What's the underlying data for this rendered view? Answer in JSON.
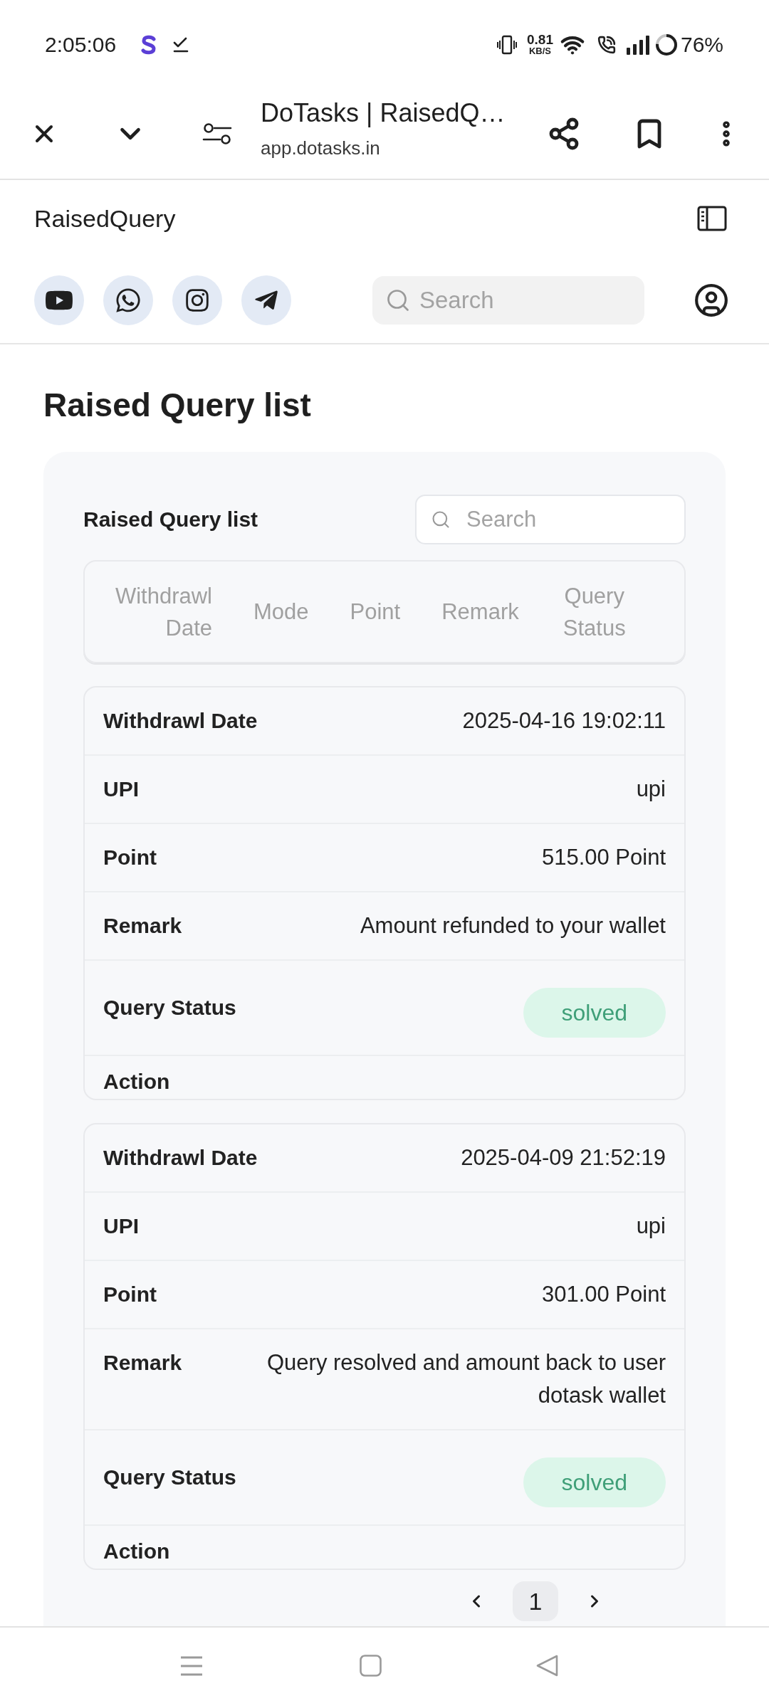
{
  "status_bar": {
    "time": "2:05:06",
    "network_speed": "0.81",
    "network_speed_unit": "KB/S",
    "battery": "76%"
  },
  "browser_bar": {
    "title": "DoTasks | RaisedQ…",
    "url": "app.dotasks.in"
  },
  "site_header": {
    "title": "RaisedQuery",
    "search": {
      "placeholder": "Search"
    }
  },
  "page_title": "Raised Query list",
  "panel": {
    "title": "Raised Query list",
    "search": {
      "placeholder": "Search"
    },
    "table": {
      "columns": [
        "Withdrawl Date",
        "Mode",
        "Point",
        "Remark",
        "Query Status"
      ]
    },
    "records": [
      {
        "fields": [
          {
            "kind": "text",
            "label": "Withdrawl Date",
            "value": "2025-04-16 19:02:11"
          },
          {
            "kind": "text",
            "label": "UPI",
            "value": "upi"
          },
          {
            "kind": "text",
            "label": "Point",
            "value": "515.00 Point"
          },
          {
            "kind": "text",
            "label": "Remark",
            "value": "Amount refunded to your wallet"
          },
          {
            "kind": "badge",
            "label": "Query Status",
            "value": "solved"
          },
          {
            "kind": "action",
            "label": "Action"
          }
        ]
      },
      {
        "fields": [
          {
            "kind": "text",
            "label": "Withdrawl Date",
            "value": "2025-04-09 21:52:19"
          },
          {
            "kind": "text",
            "label": "UPI",
            "value": "upi"
          },
          {
            "kind": "text",
            "label": "Point",
            "value": "301.00 Point"
          },
          {
            "kind": "text",
            "label": "Remark",
            "value": "Query resolved and amount back to user dotask wallet"
          },
          {
            "kind": "badge",
            "label": "Query Status",
            "value": "solved"
          },
          {
            "kind": "action",
            "label": "Action"
          }
        ]
      }
    ],
    "pagination": {
      "pages": [
        {
          "label": "1",
          "selected": true
        }
      ]
    }
  }
}
